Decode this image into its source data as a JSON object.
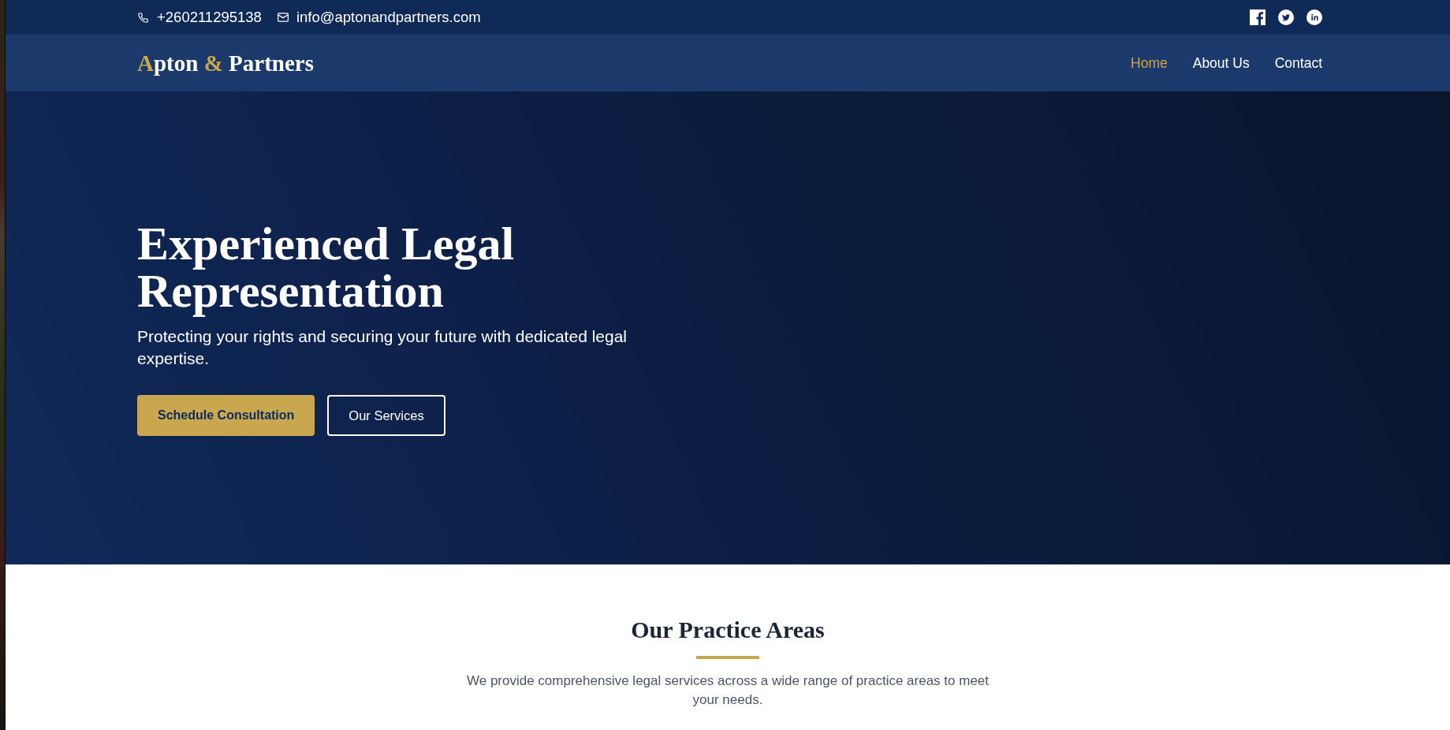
{
  "top_bar": {
    "contacts": [
      {
        "kind": "phone",
        "text": "+260211295138"
      },
      {
        "kind": "email",
        "text": "info@aptonandpartners.com"
      }
    ],
    "social_links": [
      {
        "kind": "facebook"
      },
      {
        "kind": "twitter"
      },
      {
        "kind": "linkedin"
      }
    ]
  },
  "nav": {
    "logo": {
      "parts": [
        {
          "text": "A",
          "accent": true
        },
        {
          "text": "pton ",
          "accent": false
        },
        {
          "text": "&",
          "accent": true
        },
        {
          "text": " Partners",
          "accent": false
        }
      ]
    },
    "links": [
      {
        "label": "Home",
        "selected": true
      },
      {
        "label": "About Us",
        "selected": false
      },
      {
        "label": "Contact",
        "selected": false
      }
    ]
  },
  "hero": {
    "title": "Experienced Legal Representation",
    "subtitle": "Protecting your rights and securing your future with dedicated legal expertise.",
    "buttons": [
      {
        "label": "Schedule Consultation",
        "kind": "primary"
      },
      {
        "label": "Our Services",
        "kind": "outline"
      }
    ]
  },
  "practice_areas": {
    "title": "Our Practice Areas",
    "description": "We provide comprehensive legal services across a wide range of practice areas to meet your needs."
  }
}
